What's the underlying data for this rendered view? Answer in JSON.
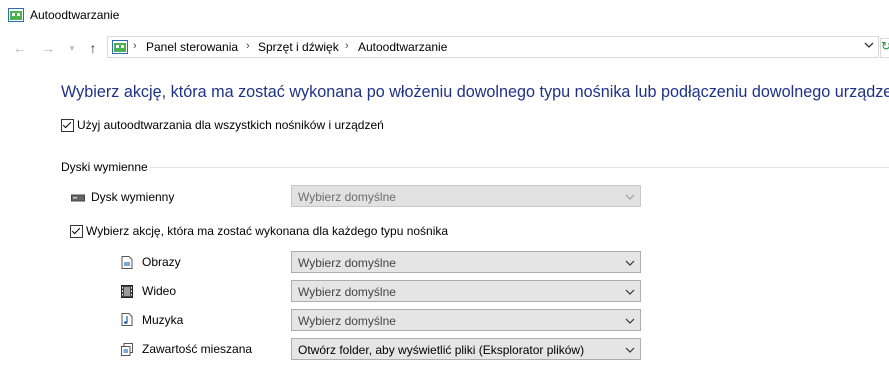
{
  "window": {
    "title": "Autoodtwarzanie"
  },
  "nav": {
    "back_icon": "arrow-left-icon",
    "forward_icon": "arrow-right-icon",
    "recent_icon": "chevron-down-icon",
    "up_icon": "arrow-up-icon",
    "breadcrumbs": [
      "Panel sterowania",
      "Sprzęt i dźwięk",
      "Autoodtwarzanie"
    ]
  },
  "heading": "Wybierz akcję, która ma zostać wykonana po włożeniu dowolnego typu nośnika lub podłączeniu dowolnego urządzenia.",
  "use_autoplay": {
    "label": "Użyj autoodtwarzania dla wszystkich nośników i urządzeń",
    "checked": true
  },
  "removable": {
    "group_title": "Dyski wymienne",
    "drive": {
      "label": "Dysk wymienny",
      "value": "Wybierz domyślne",
      "disabled": true
    },
    "per_media": {
      "label": "Wybierz akcję, która ma zostać wykonana dla każdego typu nośnika",
      "checked": true
    },
    "items": [
      {
        "label": "Obrazy",
        "icon": "image-file-icon",
        "value": "Wybierz domyślne"
      },
      {
        "label": "Wideo",
        "icon": "film-icon",
        "value": "Wybierz domyślne"
      },
      {
        "label": "Muzyka",
        "icon": "music-note-icon",
        "value": "Wybierz domyślne"
      },
      {
        "label": "Zawartość mieszana",
        "icon": "mixed-content-icon",
        "value": "Otwórz folder, aby wyświetlić pliki (Eksplorator plików)"
      }
    ]
  },
  "colors": {
    "heading": "#1e3287",
    "select_bg": "#e5e5e5",
    "border": "#adadad"
  }
}
